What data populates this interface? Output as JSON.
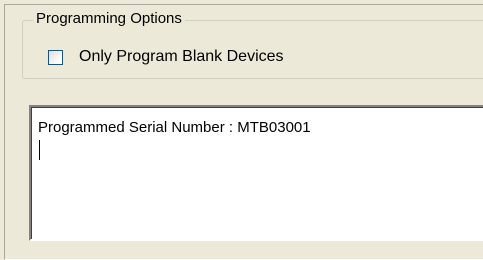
{
  "programming_options": {
    "legend": "Programming Options",
    "only_blank_devices": {
      "label": "Only Program Blank Devices",
      "checked": false
    }
  },
  "output": {
    "text": "Programmed Serial Number : MTB03001"
  }
}
